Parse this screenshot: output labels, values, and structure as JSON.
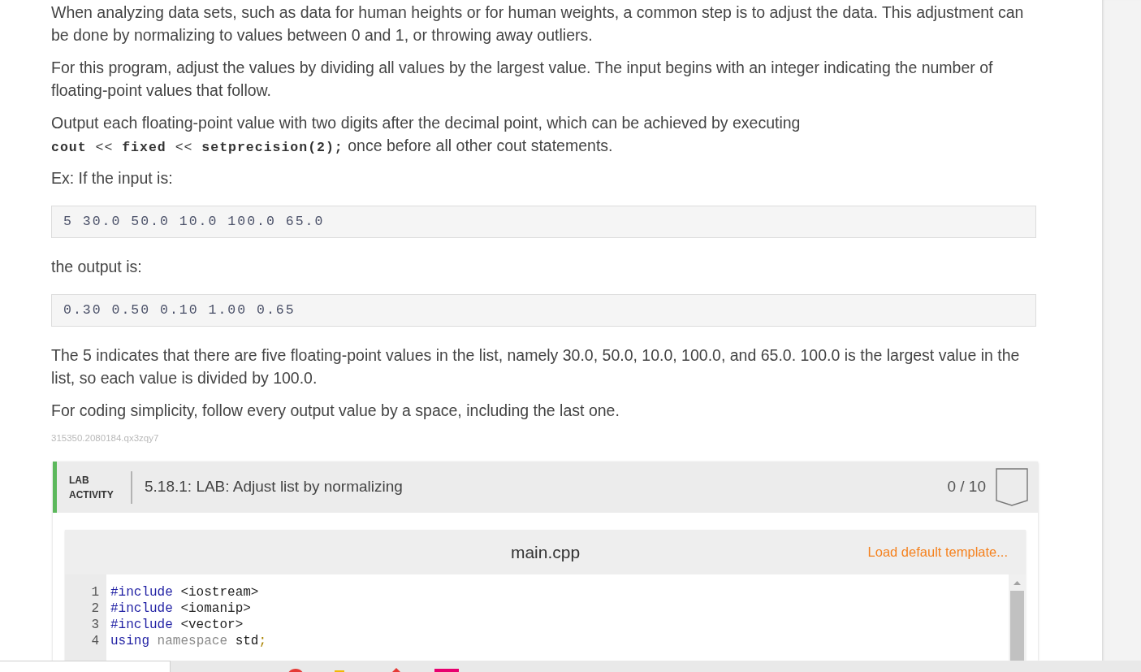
{
  "instructions": [
    {
      "kind": "paragraph",
      "segments": [
        {
          "kind": "text",
          "text": "When analyzing data sets, such as data for human heights or for human weights, a common step is to adjust the data. This adjustment can be done by normalizing to values between 0 and 1, or throwing away outliers."
        }
      ]
    },
    {
      "kind": "paragraph",
      "segments": [
        {
          "kind": "text",
          "text": "For this program, adjust the values by dividing all values by the largest value. The input begins with an integer indicating the number of floating-point values that follow."
        }
      ]
    },
    {
      "kind": "paragraph",
      "segments": [
        {
          "kind": "text",
          "text": "Output each floating-point value with two digits after the decimal point, which can be achieved by executing "
        },
        {
          "kind": "code",
          "text": "**cout** << **fixed** << **setprecision(2);**"
        },
        {
          "kind": "text",
          "text": " once before all other cout statements."
        }
      ]
    },
    {
      "kind": "paragraph",
      "segments": [
        {
          "kind": "text",
          "text": "Ex: If the input is:"
        }
      ]
    },
    {
      "kind": "sample",
      "text": "5 30.0 50.0 10.0 100.0 65.0"
    },
    {
      "kind": "paragraph",
      "segments": [
        {
          "kind": "text",
          "text": "the output is:"
        }
      ]
    },
    {
      "kind": "sample",
      "text": "0.30 0.50 0.10 1.00 0.65"
    },
    {
      "kind": "paragraph",
      "segments": [
        {
          "kind": "text",
          "text": "The 5 indicates that there are five floating-point values in the list, namely 30.0, 50.0, 10.0, 100.0, and 65.0. 100.0 is the largest value in the list, so each value is divided by 100.0."
        }
      ]
    },
    {
      "kind": "paragraph",
      "segments": [
        {
          "kind": "text",
          "text": "For coding simplicity, follow every output value by a space, including the last one."
        }
      ]
    },
    {
      "kind": "identifier",
      "text": "315350.2080184.qx3zqy7"
    }
  ],
  "lab_activity": {
    "label": "LAB ACTIVITY",
    "title": "5.18.1: LAB: Adjust list by normalizing",
    "score": "0 / 10",
    "completed": false,
    "editor": {
      "filename": "main.cpp",
      "template_link": "Load default template...",
      "lines": [
        {
          "number": "1",
          "tokens": [
            {
              "kind": "directive",
              "text": "#include"
            },
            {
              "kind": "plain",
              "text": " <iostream>"
            }
          ]
        },
        {
          "number": "2",
          "tokens": [
            {
              "kind": "directive",
              "text": "#include"
            },
            {
              "kind": "plain",
              "text": " <iomanip>"
            }
          ]
        },
        {
          "number": "3",
          "tokens": [
            {
              "kind": "directive",
              "text": "#include"
            },
            {
              "kind": "plain",
              "text": " <vector>"
            }
          ]
        },
        {
          "number": "4",
          "tokens": [
            {
              "kind": "keyword",
              "text": "using"
            },
            {
              "kind": "modifier",
              "text": " namespace"
            },
            {
              "kind": "plain",
              "text": " std"
            },
            {
              "kind": "punct",
              "text": ";"
            }
          ]
        }
      ]
    }
  }
}
